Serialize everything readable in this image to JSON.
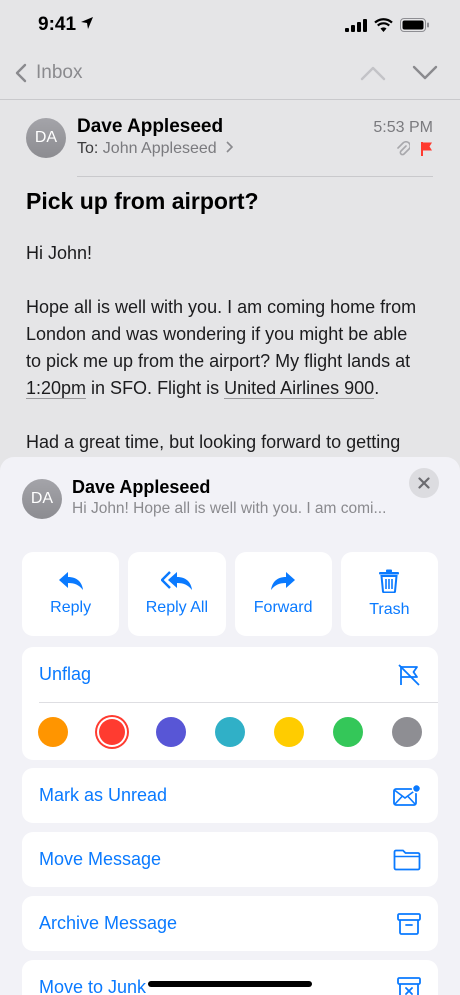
{
  "status_bar": {
    "time": "9:41"
  },
  "nav": {
    "back_label": "Inbox"
  },
  "message": {
    "avatar_initials": "DA",
    "sender": "Dave Appleseed",
    "to_prefix": "To:",
    "to_name": "John Appleseed",
    "time": "5:53 PM",
    "subject": "Pick up from airport?",
    "greeting": "Hi John!",
    "p1_a": "Hope all is well with you. I am coming home from London and was wondering if you might be able to pick me up from the airport? My flight lands at ",
    "p1_link1": "1:20pm",
    "p1_b": " in SFO. Flight is ",
    "p1_link2": "United Airlines 900",
    "p1_c": ".",
    "p2": "Had a great time, but looking forward to getting"
  },
  "sheet": {
    "avatar_initials": "DA",
    "sender": "Dave Appleseed",
    "preview": "Hi John! Hope all is well with you. I am comi...",
    "actions": [
      {
        "label": "Reply",
        "icon": "reply-icon"
      },
      {
        "label": "Reply All",
        "icon": "reply-all-icon"
      },
      {
        "label": "Forward",
        "icon": "forward-icon"
      },
      {
        "label": "Trash",
        "icon": "trash-icon"
      }
    ],
    "unflag_label": "Unflag",
    "flag_colors": [
      {
        "name": "orange",
        "color": "#ff9500",
        "selected": false
      },
      {
        "name": "red",
        "color": "#ff3b30",
        "selected": true
      },
      {
        "name": "purple",
        "color": "#5856d6",
        "selected": false
      },
      {
        "name": "blue",
        "color": "#30b0c7",
        "selected": false
      },
      {
        "name": "yellow",
        "color": "#ffcc00",
        "selected": false
      },
      {
        "name": "green",
        "color": "#34c759",
        "selected": false
      },
      {
        "name": "gray",
        "color": "#8e8e93",
        "selected": false
      }
    ],
    "mark_unread_label": "Mark as Unread",
    "move_label": "Move Message",
    "archive_label": "Archive Message",
    "junk_label": "Move to Junk"
  },
  "colors": {
    "accent": "#0a7aff",
    "flag": "#ff3b30"
  }
}
